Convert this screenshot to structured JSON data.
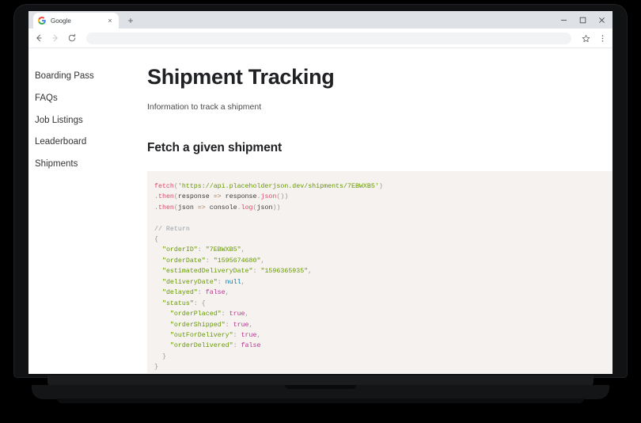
{
  "browser": {
    "tab": {
      "title": "Google",
      "favicon": "google-g-icon",
      "close_label": "×"
    },
    "newtab_label": "+",
    "window_controls": {
      "minimize": "—",
      "maximize": "□",
      "close": "✕"
    },
    "toolbar": {
      "back": "←",
      "forward": "→",
      "reload": "⟳",
      "bookmark": "☆",
      "menu": "⋮",
      "omnibox_value": "",
      "omnibox_placeholder": ""
    }
  },
  "sidebar": {
    "items": [
      {
        "label": "Boarding Pass"
      },
      {
        "label": "FAQs"
      },
      {
        "label": "Job Listings"
      },
      {
        "label": "Leaderboard"
      },
      {
        "label": "Shipments"
      }
    ]
  },
  "main": {
    "title": "Shipment Tracking",
    "subtitle": "Information to track a shipment",
    "section_title": "Fetch a given shipment",
    "code": {
      "fetch_keyword": "fetch",
      "url": "'https://api.placeholderjson.dev/shipments/7EBWXB5'",
      "line2": ".then(response => response.json())",
      "line3": ".then(json => console.log(json))",
      "comment": "// Return",
      "shipment_id": "7EBWXB5",
      "fields": {
        "orderID_key": "\"orderID\"",
        "orderID_value": "\"7EBWXB5\"",
        "orderDate_key": "\"orderDate\"",
        "orderDate_value": "\"1595674680\"",
        "estimatedDeliveryDate_key": "\"estimatedDeliveryDate\"",
        "estimatedDeliveryDate_value": "\"1596365935\"",
        "deliveryDate_key": "\"deliveryDate\"",
        "deliveryDate_value": "null",
        "delayed_key": "\"delayed\"",
        "delayed_value": "false",
        "status_key": "\"status\"",
        "orderPlaced_key": "\"orderPlaced\"",
        "orderPlaced_value": "true",
        "orderShipped_key": "\"orderShipped\"",
        "orderShipped_value": "true",
        "outForDelivery_key": "\"outForDelivery\"",
        "outForDelivery_value": "true",
        "orderDelivered_key": "\"orderDelivered\"",
        "orderDelivered_value": "false"
      }
    }
  },
  "colors": {
    "code_background": "#f6f2f0",
    "string": "#669900",
    "function": "#dd4a68",
    "boolean": "#b5388e",
    "keyword": "#0077aa",
    "comment": "#9aa0a6",
    "page_background": "#ffffff",
    "frame": "#000000"
  }
}
